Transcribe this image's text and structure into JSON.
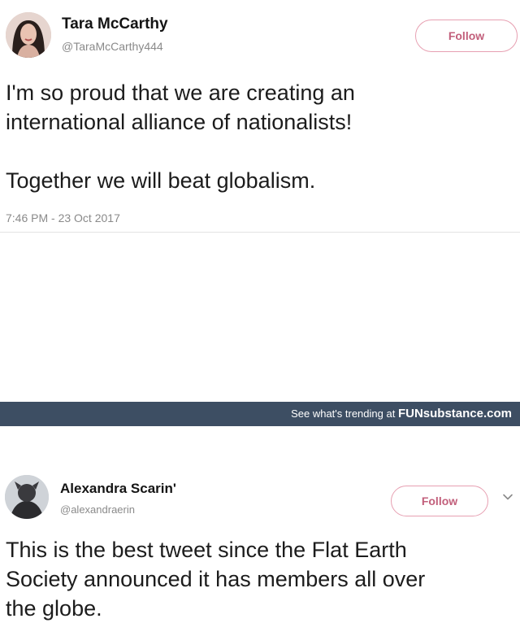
{
  "tweets": [
    {
      "name": "Tara McCarthy",
      "handle": "@TaraMcCarthy444",
      "follow_label": "Follow",
      "text": "I'm so proud that we are creating an\ninternational alliance of nationalists!\n\nTogether we will beat globalism.",
      "timestamp": "7:46 PM - 23 Oct 2017"
    },
    {
      "name": "Alexandra Scarin'",
      "handle": "@alexandraerin",
      "follow_label": "Follow",
      "text": "This is the best tweet since the Flat Earth\nSociety announced it has members all over\nthe globe."
    }
  ],
  "footer": {
    "prefix": "See what's trending at",
    "brand": "FUNsubstance.com"
  },
  "colors": {
    "follow_border": "#e7a0b2",
    "follow_text": "#c25f7b",
    "footer_bg": "#3d4e63"
  },
  "icons": {
    "chevron": "chevron-down-icon"
  }
}
